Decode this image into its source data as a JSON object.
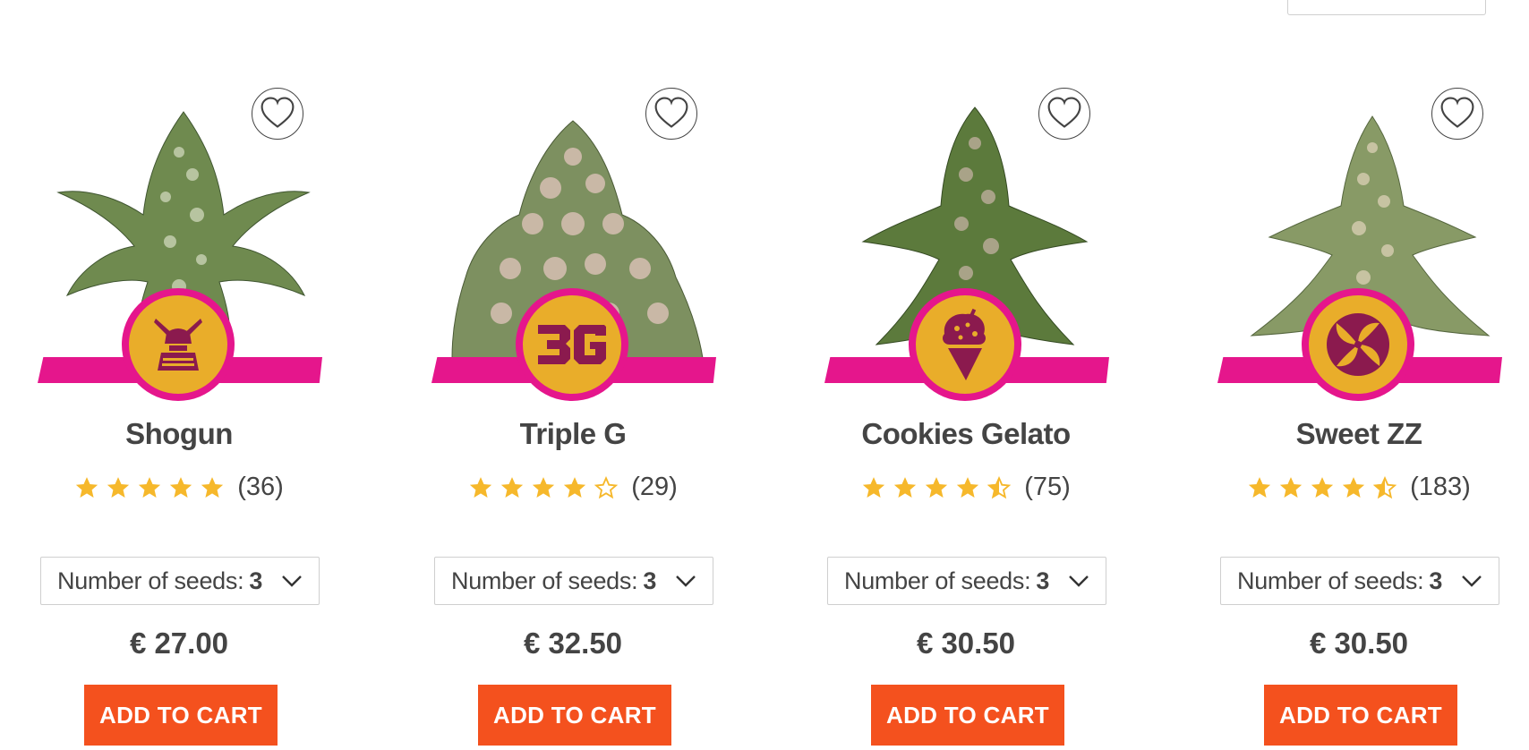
{
  "colors": {
    "accent_pink": "#e5168c",
    "badge_gold": "#e9ad2a",
    "badge_icon": "#8b1a4e",
    "cta": "#f4511e",
    "star": "#f6b82b"
  },
  "products": [
    {
      "name": "Shogun",
      "rating": 5.0,
      "review_count": "(36)",
      "seeds_label": "Number of seeds:",
      "seeds_value": "3",
      "price": "€ 27.00",
      "cart_label": "ADD TO CART",
      "badge_icon": "samurai-armor-icon"
    },
    {
      "name": "Triple G",
      "rating": 4.0,
      "review_count": "(29)",
      "seeds_label": "Number of seeds:",
      "seeds_value": "3",
      "price": "€ 32.50",
      "cart_label": "ADD TO CART",
      "badge_icon": "3g-text-icon",
      "badge_text": "3G"
    },
    {
      "name": "Cookies Gelato",
      "rating": 4.5,
      "review_count": "(75)",
      "seeds_label": "Number of seeds:",
      "seeds_value": "3",
      "price": "€ 30.50",
      "cart_label": "ADD TO CART",
      "badge_icon": "ice-cream-cone-icon"
    },
    {
      "name": "Sweet ZZ",
      "rating": 4.5,
      "review_count": "(183)",
      "seeds_label": "Number of seeds:",
      "seeds_value": "3",
      "price": "€ 30.50",
      "cart_label": "ADD TO CART",
      "badge_icon": "swirl-candy-icon"
    }
  ]
}
